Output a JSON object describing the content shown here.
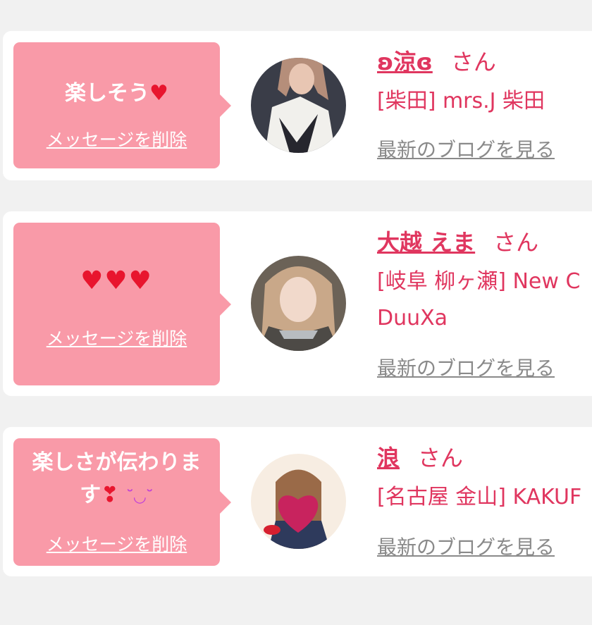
{
  "items": [
    {
      "message": "楽しそう",
      "message_emoji": "♥",
      "delete_label": "メッセージを削除",
      "name": "ʚ涼ɞ",
      "honorific": "さん",
      "shop_line1": "[柴田] mrs.J 柴田",
      "shop_line2": "",
      "blog_label": "最新のブログを見る"
    },
    {
      "message": "♥♥♥",
      "delete_label": "メッセージを削除",
      "name": "大越 えま",
      "honorific": "さん",
      "shop_line1": "[岐阜 柳ヶ瀬] New C",
      "shop_line2": "DuuXa",
      "blog_label": "最新のブログを見る"
    },
    {
      "message_line1": "楽しさが伝わりま",
      "message_line2": "す",
      "message_emoji": "❣",
      "message_emoji2": "˘◡˘",
      "delete_label": "メッセージを削除",
      "name": "浪",
      "honorific": "さん",
      "shop_line1": "[名古屋 金山] KAKUF",
      "shop_line2": "",
      "blog_label": "最新のブログを見る"
    }
  ],
  "colors": {
    "bubble": "#f99aa8",
    "accent": "#e0365f",
    "link_gray": "#8a8a8a",
    "background": "#f1f1f1"
  }
}
